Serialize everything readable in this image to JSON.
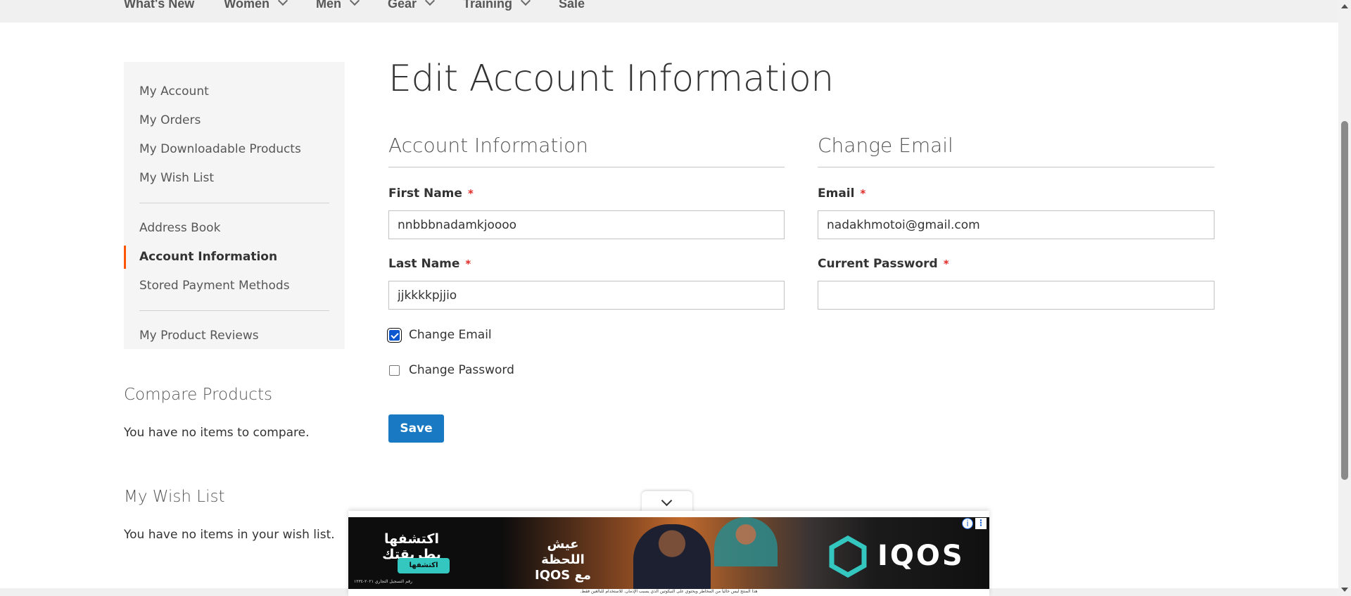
{
  "nav": {
    "items": [
      {
        "label": "What's New",
        "has_dropdown": false
      },
      {
        "label": "Women",
        "has_dropdown": true
      },
      {
        "label": "Men",
        "has_dropdown": true
      },
      {
        "label": "Gear",
        "has_dropdown": true
      },
      {
        "label": "Training",
        "has_dropdown": true
      },
      {
        "label": "Sale",
        "has_dropdown": false
      }
    ]
  },
  "sidebar": {
    "items": [
      {
        "label": "My Account"
      },
      {
        "label": "My Orders"
      },
      {
        "label": "My Downloadable Products"
      },
      {
        "label": "My Wish List"
      },
      {
        "label": "Address Book"
      },
      {
        "label": "Account Information",
        "active": true
      },
      {
        "label": "Stored Payment Methods"
      },
      {
        "label": "My Product Reviews"
      }
    ],
    "accent_color": "#ff5501"
  },
  "compare": {
    "title": "Compare Products",
    "text": "You have no items to compare."
  },
  "wishlist": {
    "title": "My Wish List",
    "text": "You have no items in your wish list."
  },
  "main": {
    "title": "Edit Account Information",
    "account_info": {
      "title": "Account Information",
      "first_name": {
        "label": "First Name",
        "value": "nnbbbnadamkjoooo"
      },
      "last_name": {
        "label": "Last Name",
        "value": "jjkkkkpjjio"
      },
      "change_email": {
        "label": "Change Email",
        "checked": true
      },
      "change_password": {
        "label": "Change Password",
        "checked": false
      }
    },
    "change_email": {
      "title": "Change Email",
      "email": {
        "label": "Email",
        "value": "nadakhmotoi@gmail.com"
      },
      "current_password": {
        "label": "Current Password",
        "value": ""
      }
    },
    "required_marker": "*",
    "save_label": "Save",
    "save_color": "#1979c3"
  },
  "ad": {
    "headline_left": "اكتشفها بطريقتك",
    "cta": "اكتشفها",
    "fine_print": "رقم التسجيل التجاري ٢٠٢١-١٢٣٤",
    "headline_mid_1": "عيش اللحظة",
    "headline_mid_2": "مع IQOS",
    "brand": "IQOS",
    "info_icon": "info-icon",
    "menu_icon": "more-vertical-icon",
    "bottom_text": "هذا المنتج ليس خالياً من المخاطر ويحتوي على النيكوتين الذي يسبب الإدمان. للاستخدام للبالغين فقط."
  }
}
